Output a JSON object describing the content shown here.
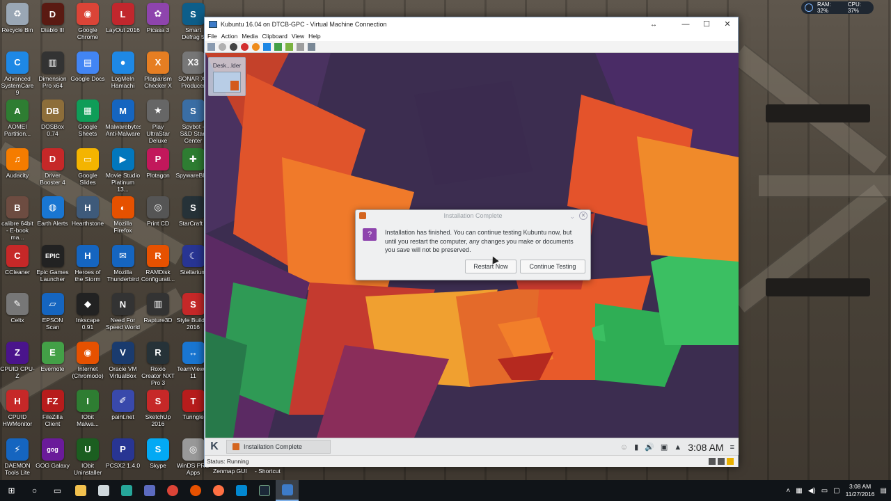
{
  "perf_widget": {
    "ram": "RAM: 32%",
    "cpu": "CPU: 37%"
  },
  "desktop_icons": [
    {
      "label": "Recycle Bin",
      "color": "#9aa7b5",
      "glyph": "♻"
    },
    {
      "label": "Diablo III",
      "color": "#5a1a12",
      "glyph": "D"
    },
    {
      "label": "Google Chrome",
      "color": "#db4437",
      "glyph": "◉"
    },
    {
      "label": "LayOut 2016",
      "color": "#c1272d",
      "glyph": "L"
    },
    {
      "label": "Picasa 3",
      "color": "#8e44ad",
      "glyph": "✿"
    },
    {
      "label": "Smart Defrag 5",
      "color": "#0d5e8a",
      "glyph": "S"
    },
    {
      "label": "Advanced SystemCare 9",
      "color": "#1e88e5",
      "glyph": "C"
    },
    {
      "label": "Dimension Pro x64",
      "color": "#333",
      "glyph": "▥"
    },
    {
      "label": "Google Docs",
      "color": "#4285f4",
      "glyph": "▤"
    },
    {
      "label": "LogMeIn Hamachi",
      "color": "#1e88e5",
      "glyph": "●"
    },
    {
      "label": "Plagiarism Checker X",
      "color": "#e67e22",
      "glyph": "X"
    },
    {
      "label": "SONAR X3 Producer",
      "color": "#777",
      "glyph": "X3"
    },
    {
      "label": "AOMEI Partition...",
      "color": "#2e7d32",
      "glyph": "A"
    },
    {
      "label": "DOSBox 0.74",
      "color": "#8d6e3a",
      "glyph": "DB"
    },
    {
      "label": "Google Sheets",
      "color": "#0f9d58",
      "glyph": "▦"
    },
    {
      "label": "Malwarebytes Anti-Malware",
      "color": "#1565c0",
      "glyph": "M"
    },
    {
      "label": "Play UltraStar Deluxe",
      "color": "#666",
      "glyph": "★"
    },
    {
      "label": "Spybot - S&D Start Center",
      "color": "#3a6ea5",
      "glyph": "S"
    },
    {
      "label": "Audacity",
      "color": "#f57c00",
      "glyph": "♫"
    },
    {
      "label": "Driver Booster 4",
      "color": "#c62828",
      "glyph": "D"
    },
    {
      "label": "Google Slides",
      "color": "#f4b400",
      "glyph": "▭"
    },
    {
      "label": "Movie Studio Platinum 13...",
      "color": "#0277bd",
      "glyph": "▶"
    },
    {
      "label": "Plotagon",
      "color": "#c2185b",
      "glyph": "P"
    },
    {
      "label": "SpywareBlaster",
      "color": "#2e7d32",
      "glyph": "✚"
    },
    {
      "label": "calibre 64bit - E-book ma...",
      "color": "#6d4c41",
      "glyph": "B"
    },
    {
      "label": "Earth Alerts",
      "color": "#1976d2",
      "glyph": "◍"
    },
    {
      "label": "Hearthstone",
      "color": "#3e5a7a",
      "glyph": "H"
    },
    {
      "label": "Mozilla Firefox",
      "color": "#e65100",
      "glyph": "◐"
    },
    {
      "label": "Print CD",
      "color": "#555",
      "glyph": "◎"
    },
    {
      "label": "StarCraft II",
      "color": "#263238",
      "glyph": "S"
    },
    {
      "label": "CCleaner",
      "color": "#c62828",
      "glyph": "C"
    },
    {
      "label": "Epic Games Launcher",
      "color": "#222",
      "glyph": "EPIC"
    },
    {
      "label": "Heroes of the Storm",
      "color": "#1565c0",
      "glyph": "H"
    },
    {
      "label": "Mozilla Thunderbird",
      "color": "#1565c0",
      "glyph": "✉"
    },
    {
      "label": "RAMDisk Configurati...",
      "color": "#e65100",
      "glyph": "R"
    },
    {
      "label": "Stellarium",
      "color": "#283593",
      "glyph": "☾"
    },
    {
      "label": "Celtx",
      "color": "#777",
      "glyph": "✎"
    },
    {
      "label": "EPSON Scan",
      "color": "#1565c0",
      "glyph": "▱"
    },
    {
      "label": "Inkscape 0.91",
      "color": "#222",
      "glyph": "◆"
    },
    {
      "label": "Need For Speed World",
      "color": "#333",
      "glyph": "N"
    },
    {
      "label": "Rapture3D",
      "color": "#333",
      "glyph": "▥"
    },
    {
      "label": "Style Builder 2016",
      "color": "#c62828",
      "glyph": "S"
    },
    {
      "label": "CPUID CPU-Z",
      "color": "#4a148c",
      "glyph": "Z"
    },
    {
      "label": "Evernote",
      "color": "#43a047",
      "glyph": "E"
    },
    {
      "label": "Internet (Chromodo)",
      "color": "#e65100",
      "glyph": "◉"
    },
    {
      "label": "Oracle VM VirtualBox",
      "color": "#1a3b6e",
      "glyph": "V"
    },
    {
      "label": "Roxio Creator NXT Pro 3",
      "color": "#263238",
      "glyph": "R"
    },
    {
      "label": "TeamViewer 11",
      "color": "#1976d2",
      "glyph": "↔"
    },
    {
      "label": "CPUID HWMonitor",
      "color": "#c62828",
      "glyph": "H"
    },
    {
      "label": "FileZilla Client",
      "color": "#b71c1c",
      "glyph": "FZ"
    },
    {
      "label": "IObit Malwa...",
      "color": "#2e7d32",
      "glyph": "I"
    },
    {
      "label": "paint.net",
      "color": "#3949ab",
      "glyph": "✐"
    },
    {
      "label": "SketchUp 2016",
      "color": "#c62828",
      "glyph": "S"
    },
    {
      "label": "Tunngle",
      "color": "#b71c1c",
      "glyph": "T"
    },
    {
      "label": "DAEMON Tools Lite",
      "color": "#1565c0",
      "glyph": "⚡"
    },
    {
      "label": "GOG Galaxy",
      "color": "#6a1b9a",
      "glyph": "gog"
    },
    {
      "label": "IObit Uninstaller",
      "color": "#1b5e20",
      "glyph": "U"
    },
    {
      "label": "PCSX2 1.4.0",
      "color": "#283593",
      "glyph": "P"
    },
    {
      "label": "Skype",
      "color": "#03a9f4",
      "glyph": "S"
    },
    {
      "label": "WinDS PRO Apps",
      "color": "#999",
      "glyph": "◎"
    }
  ],
  "vm_window": {
    "title": "Kubuntu 16.04 on DTCB-GPC - Virtual Machine Connection",
    "menu": [
      "File",
      "Action",
      "Media",
      "Clipboard",
      "View",
      "Help"
    ],
    "folder_view_title": "Desk...lder",
    "status": "Status: Running"
  },
  "dialog": {
    "title": "Installation Complete",
    "message": "Installation has finished. You can continue testing Kubuntu now, but until you restart the computer, any changes you make or documents you save will not be preserved.",
    "restart_button": "Restart Now",
    "continue_button": "Continue Testing"
  },
  "kde_panel": {
    "task_label": "Installation Complete",
    "clock": "3:08 AM"
  },
  "host_desktop_extra": {
    "zenmap_label": "Zenmap GUI",
    "shortcut_label": "- Shortcut"
  },
  "host_taskbar": {
    "time": "3:08 AM",
    "date": "11/27/2016"
  }
}
